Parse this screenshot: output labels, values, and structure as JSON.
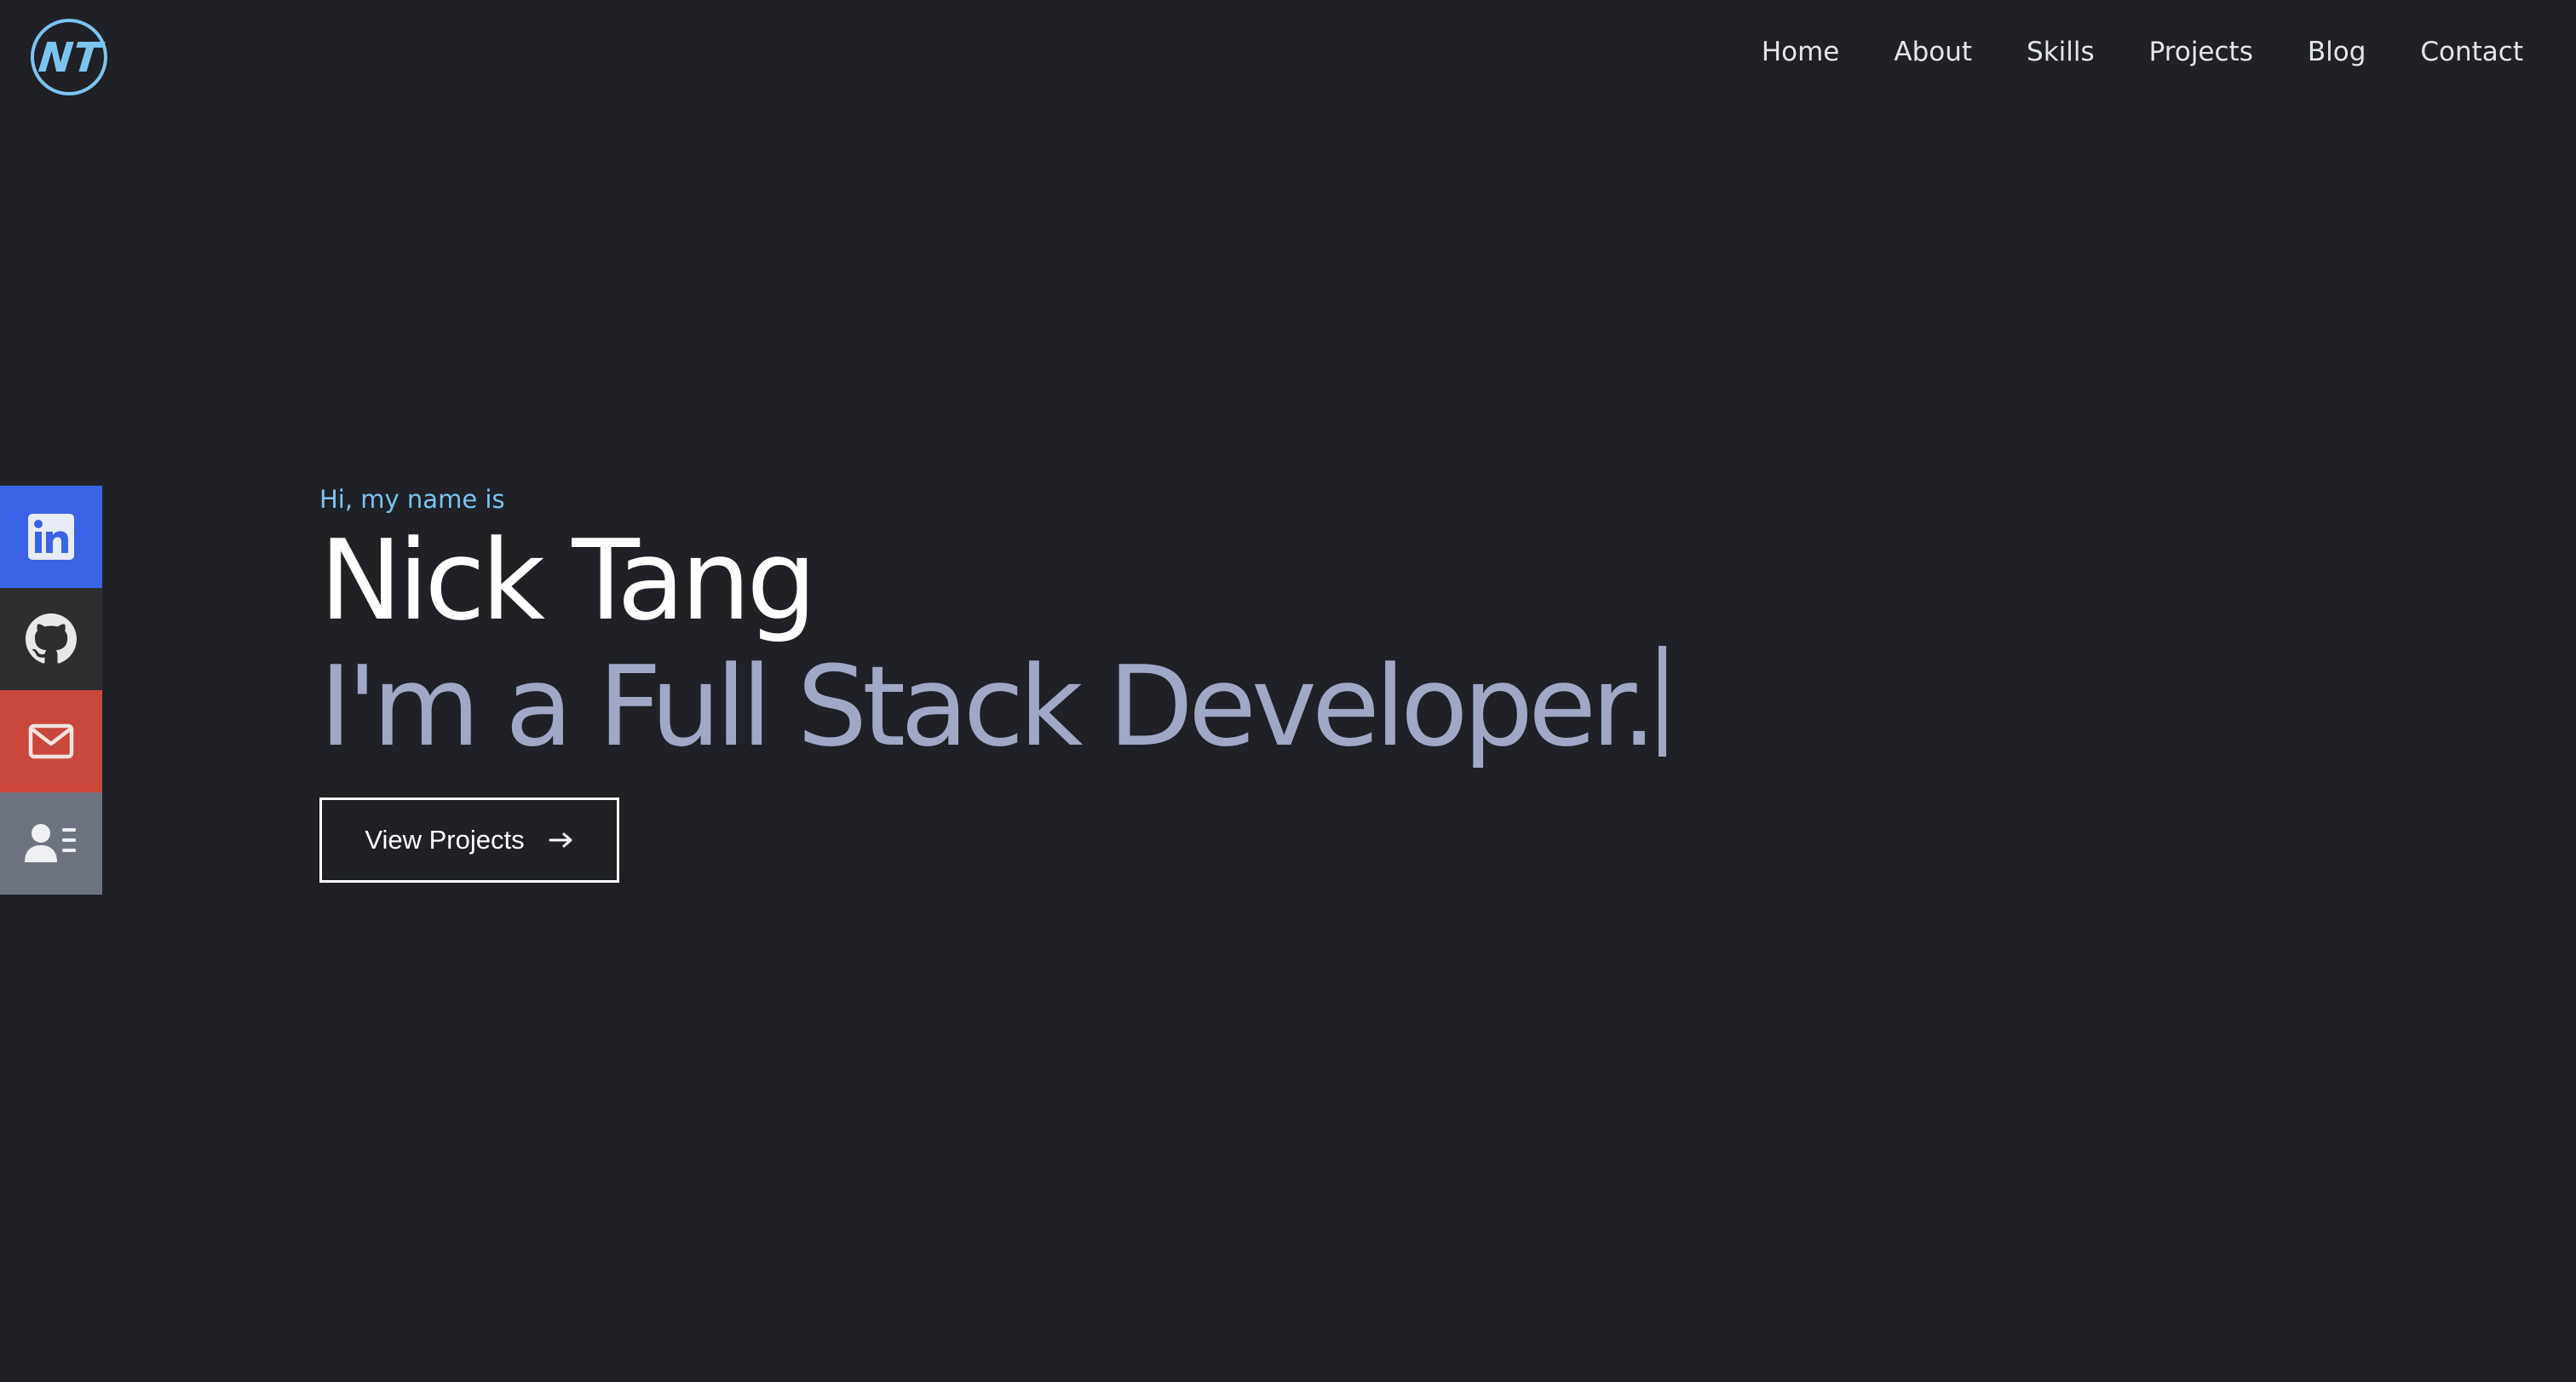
{
  "header": {
    "logo_text": "NT",
    "nav": [
      {
        "label": "Home"
      },
      {
        "label": "About"
      },
      {
        "label": "Skills"
      },
      {
        "label": "Projects"
      },
      {
        "label": "Blog"
      },
      {
        "label": "Contact"
      }
    ]
  },
  "social": [
    {
      "icon": "linkedin-icon",
      "color": "#3b63e6"
    },
    {
      "icon": "github-icon",
      "color": "#2e2e30"
    },
    {
      "icon": "mail-icon",
      "color": "#c9473b"
    },
    {
      "icon": "contact-card-icon",
      "color": "#6e7380"
    }
  ],
  "hero": {
    "greeting": "Hi, my name is",
    "name": "Nick Tang",
    "tagline": "I'm a Full Stack Developer.",
    "cta_label": "View Projects"
  },
  "colors": {
    "background": "#1f2127",
    "accent": "#7cc4f0",
    "tagline": "#a1a8c5"
  }
}
